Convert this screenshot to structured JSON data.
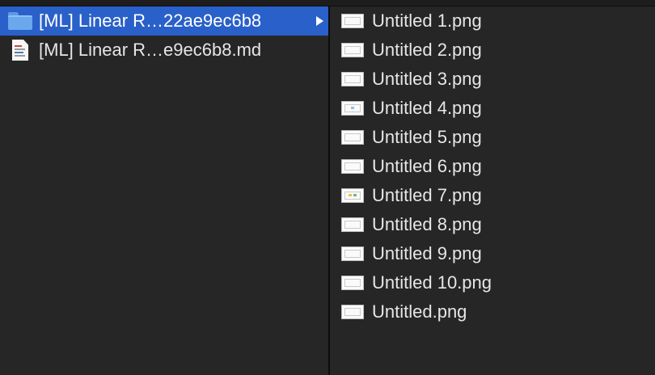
{
  "left_column": {
    "items": [
      {
        "label": "[ML] Linear R…22ae9ec6b8",
        "icon": "folder-icon",
        "selected": true
      },
      {
        "label": "[ML] Linear R…e9ec6b8.md",
        "icon": "markdown-file-icon",
        "selected": false
      }
    ]
  },
  "right_column": {
    "items": [
      {
        "label": "Untitled 1.png",
        "icon": "image-thumbnail-icon"
      },
      {
        "label": "Untitled 2.png",
        "icon": "image-thumbnail-icon"
      },
      {
        "label": "Untitled 3.png",
        "icon": "image-thumbnail-icon"
      },
      {
        "label": "Untitled 4.png",
        "icon": "image-thumbnail-icon"
      },
      {
        "label": "Untitled 5.png",
        "icon": "image-thumbnail-icon"
      },
      {
        "label": "Untitled 6.png",
        "icon": "image-thumbnail-icon"
      },
      {
        "label": "Untitled 7.png",
        "icon": "image-thumbnail-icon"
      },
      {
        "label": "Untitled 8.png",
        "icon": "image-thumbnail-icon"
      },
      {
        "label": "Untitled 9.png",
        "icon": "image-thumbnail-icon"
      },
      {
        "label": "Untitled 10.png",
        "icon": "image-thumbnail-icon"
      },
      {
        "label": "Untitled.png",
        "icon": "image-thumbnail-icon"
      }
    ]
  },
  "colors": {
    "selection": "#2a60c9",
    "background": "#272627",
    "text": "#e6e6e6"
  }
}
